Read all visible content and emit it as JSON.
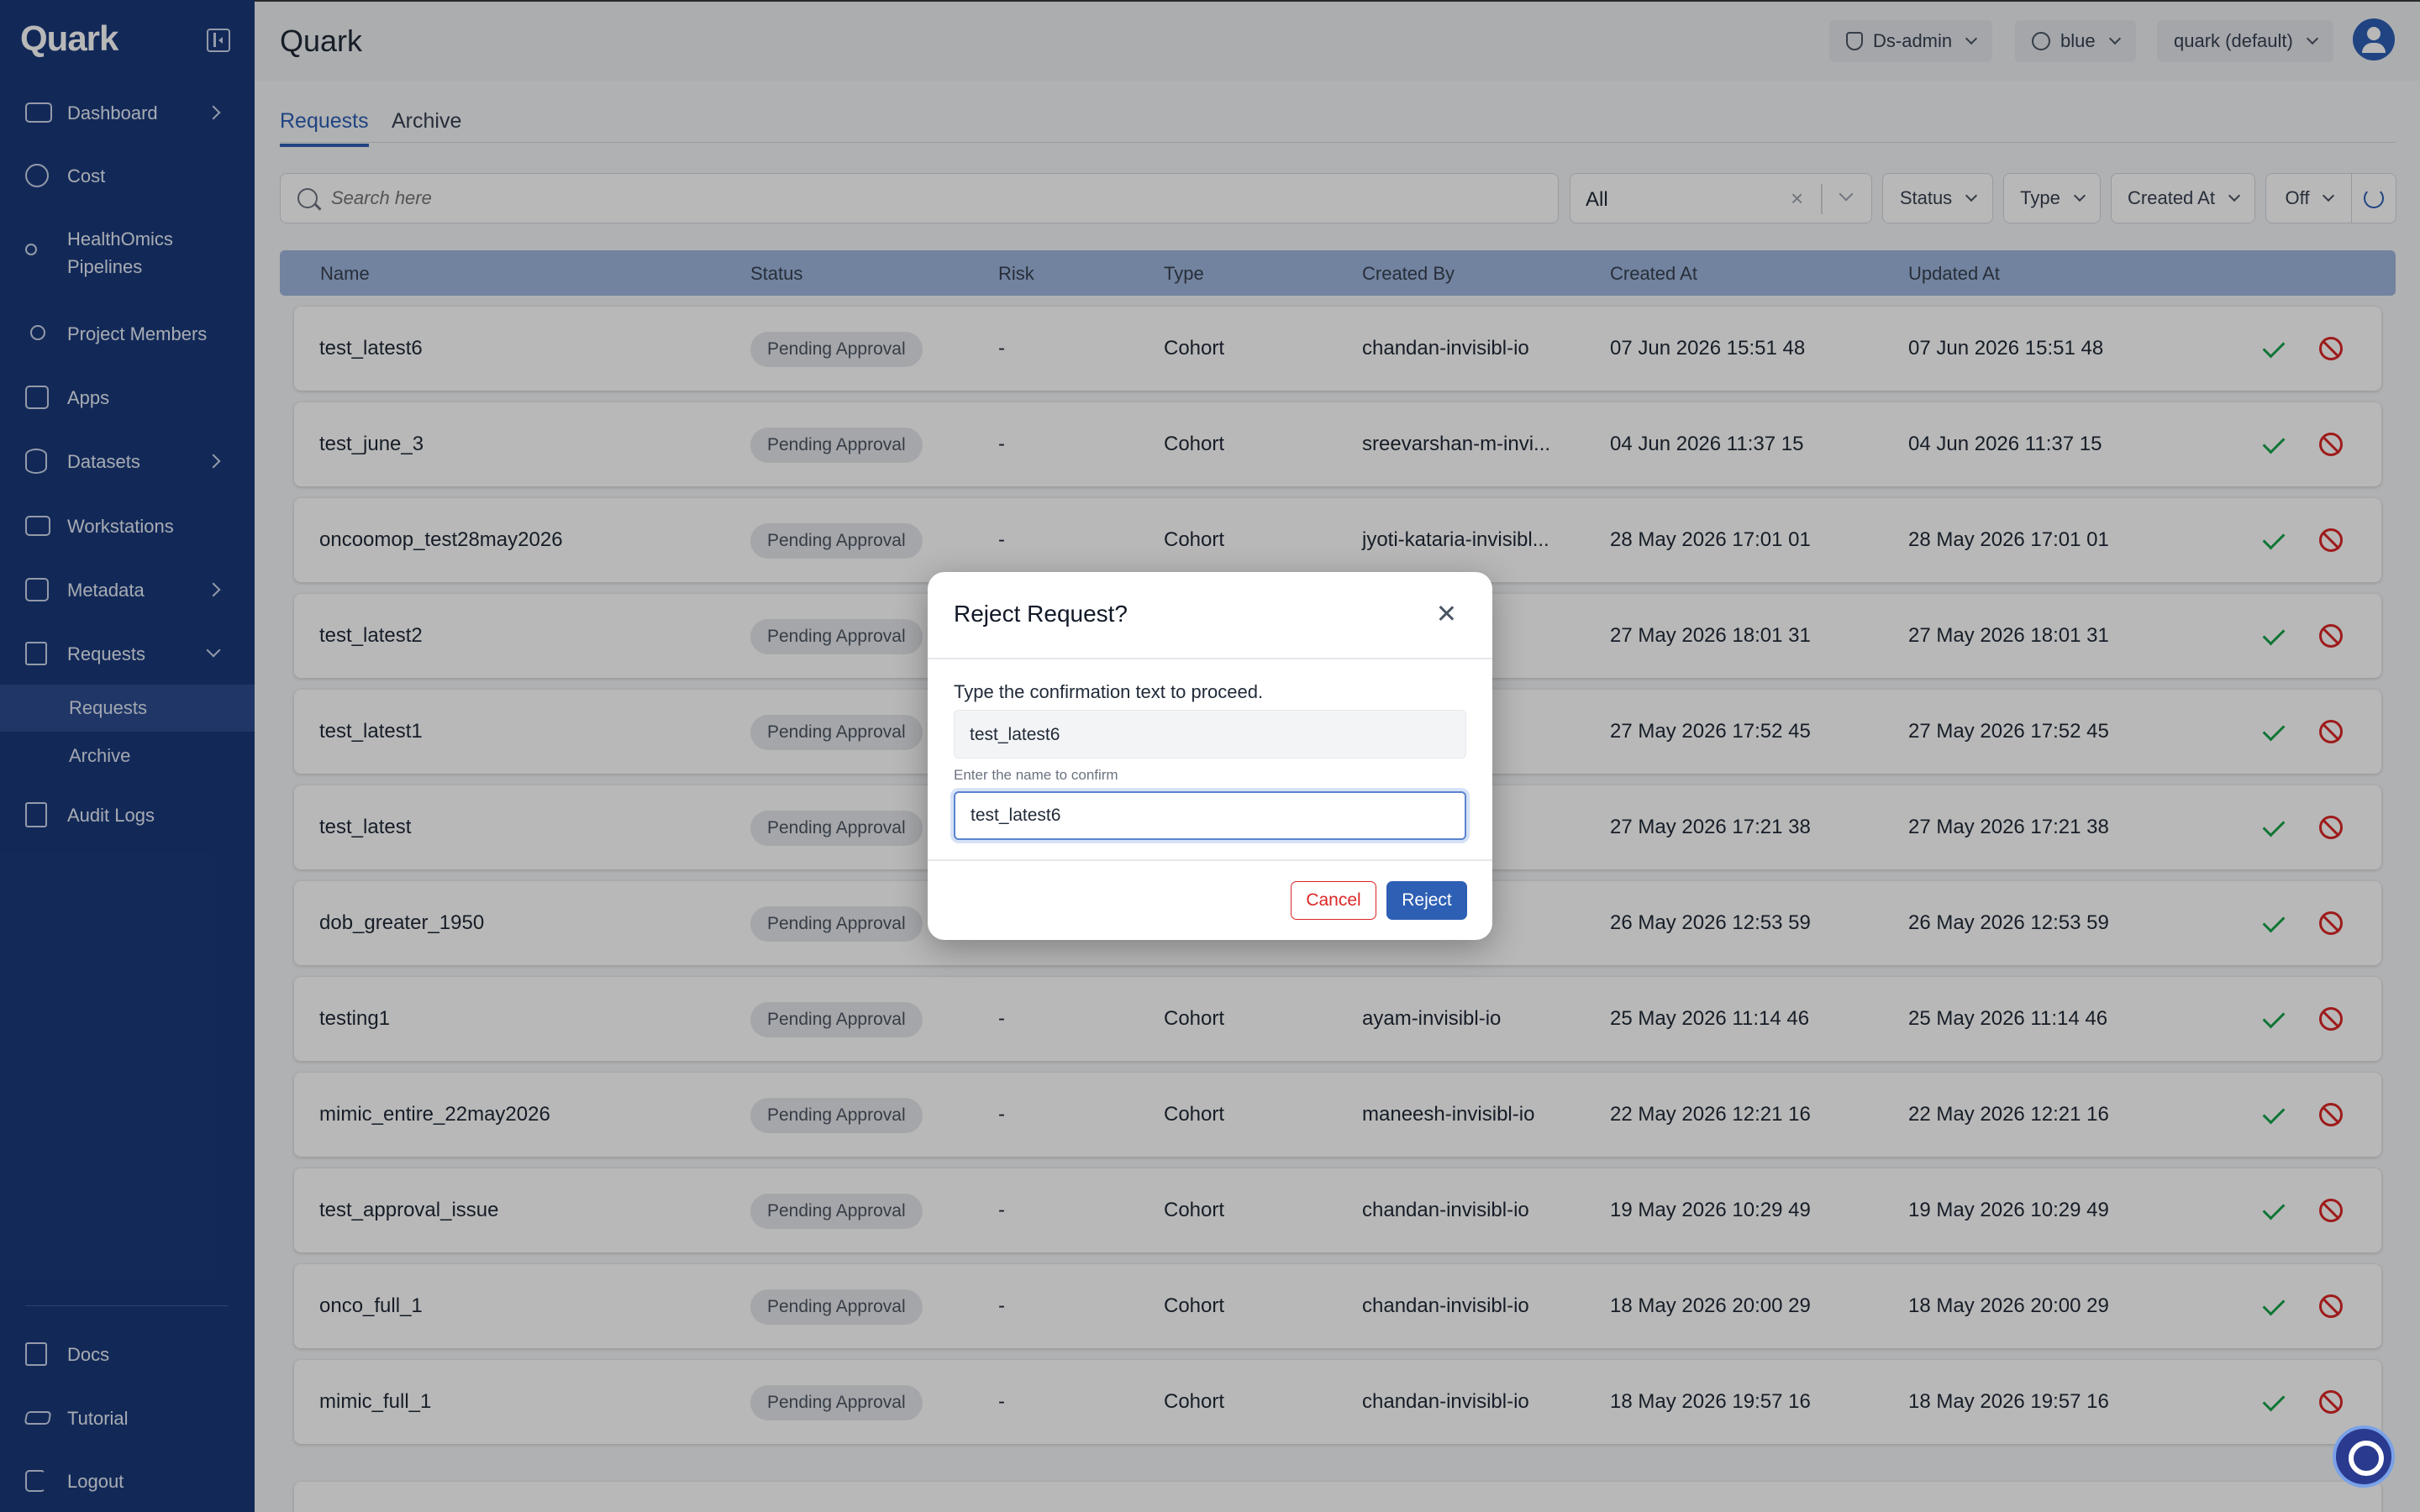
{
  "app": {
    "brand": "Quark",
    "page_title": "Quark"
  },
  "sidebar": {
    "items": [
      {
        "label": "Dashboard",
        "icon": "dashboard-icon",
        "chevron": "right"
      },
      {
        "label": "Cost",
        "icon": "dollar-icon"
      },
      {
        "label_line1": "HealthOmics",
        "label_line2": "Pipelines",
        "icon": "pipeline-icon"
      },
      {
        "label": "Project Members",
        "icon": "users-icon"
      },
      {
        "label": "Apps",
        "icon": "apps-icon"
      },
      {
        "label": "Datasets",
        "icon": "database-icon",
        "chevron": "right"
      },
      {
        "label": "Workstations",
        "icon": "workstation-icon"
      },
      {
        "label": "Metadata",
        "icon": "code-icon",
        "chevron": "right"
      },
      {
        "label": "Requests",
        "icon": "requests-icon",
        "chevron": "down"
      },
      {
        "label": "Audit Logs",
        "icon": "audit-icon"
      }
    ],
    "sub_items": [
      {
        "label": "Requests",
        "active": true
      },
      {
        "label": "Archive",
        "active": false
      }
    ],
    "footer": [
      {
        "label": "Docs",
        "icon": "docs-icon"
      },
      {
        "label": "Tutorial",
        "icon": "graduation-cap-icon"
      },
      {
        "label": "Logout",
        "icon": "logout-icon"
      }
    ]
  },
  "header": {
    "role": "Ds-admin",
    "theme": "blue",
    "project": "quark (default)"
  },
  "tabs": [
    {
      "label": "Requests",
      "active": true
    },
    {
      "label": "Archive",
      "active": false
    }
  ],
  "filters": {
    "search_placeholder": "Search here",
    "select_value": "All",
    "clear": "×",
    "status": "Status",
    "type": "Type",
    "created_at": "Created At",
    "auto_refresh": "Off"
  },
  "table": {
    "headers": [
      "Name",
      "Status",
      "Risk",
      "Type",
      "Created By",
      "Created At",
      "Updated At"
    ],
    "rows": [
      {
        "name": "test_latest6",
        "status": "Pending Approval",
        "risk": "-",
        "type": "Cohort",
        "created_by": "chandan-invisibl-io",
        "created_at": "07 Jun 2026 15:51 48",
        "updated_at": "07 Jun 2026 15:51 48"
      },
      {
        "name": "test_june_3",
        "status": "Pending Approval",
        "risk": "-",
        "type": "Cohort",
        "created_by": "sreevarshan-m-invi...",
        "created_at": "04 Jun 2026 11:37 15",
        "updated_at": "04 Jun 2026 11:37 15"
      },
      {
        "name": "oncoomop_test28may2026",
        "status": "Pending Approval",
        "risk": "-",
        "type": "Cohort",
        "created_by": "jyoti-kataria-invisibl...",
        "created_at": "28 May 2026 17:01 01",
        "updated_at": "28 May 2026 17:01 01"
      },
      {
        "name": "test_latest2",
        "status": "Pending Approval",
        "risk": "",
        "type": "",
        "created_by": "bl-io",
        "created_at": "27 May 2026 18:01 31",
        "updated_at": "27 May 2026 18:01 31"
      },
      {
        "name": "test_latest1",
        "status": "Pending Approval",
        "risk": "",
        "type": "",
        "created_by": "bl-io",
        "created_at": "27 May 2026 17:52 45",
        "updated_at": "27 May 2026 17:52 45"
      },
      {
        "name": "test_latest",
        "status": "Pending Approval",
        "risk": "",
        "type": "",
        "created_by": "bl-io",
        "created_at": "27 May 2026 17:21 38",
        "updated_at": "27 May 2026 17:21 38"
      },
      {
        "name": "dob_greater_1950",
        "status": "Pending Approval",
        "risk": "",
        "type": "",
        "created_by": "a-invi...",
        "created_at": "26 May 2026 12:53 59",
        "updated_at": "26 May 2026 12:53 59"
      },
      {
        "name": "testing1",
        "status": "Pending Approval",
        "risk": "-",
        "type": "Cohort",
        "created_by": "ayam-invisibl-io",
        "created_at": "25 May 2026 11:14 46",
        "updated_at": "25 May 2026 11:14 46"
      },
      {
        "name": "mimic_entire_22may2026",
        "status": "Pending Approval",
        "risk": "-",
        "type": "Cohort",
        "created_by": "maneesh-invisibl-io",
        "created_at": "22 May 2026 12:21 16",
        "updated_at": "22 May 2026 12:21 16"
      },
      {
        "name": "test_approval_issue",
        "status": "Pending Approval",
        "risk": "-",
        "type": "Cohort",
        "created_by": "chandan-invisibl-io",
        "created_at": "19 May 2026 10:29 49",
        "updated_at": "19 May 2026 10:29 49"
      },
      {
        "name": "onco_full_1",
        "status": "Pending Approval",
        "risk": "-",
        "type": "Cohort",
        "created_by": "chandan-invisibl-io",
        "created_at": "18 May 2026 20:00 29",
        "updated_at": "18 May 2026 20:00 29"
      },
      {
        "name": "mimic_full_1",
        "status": "Pending Approval",
        "risk": "-",
        "type": "Cohort",
        "created_by": "chandan-invisibl-io",
        "created_at": "18 May 2026 19:57 16",
        "updated_at": "18 May 2026 19:57 16"
      }
    ]
  },
  "modal": {
    "title": "Reject Request?",
    "prompt": "Type the confirmation text to proceed.",
    "confirmation_text": "test_latest6",
    "helper": "Enter the name to confirm",
    "input_value": "test_latest6",
    "cancel_label": "Cancel",
    "reject_label": "Reject"
  },
  "colors": {
    "sidebar_bg": "#1a3a7a",
    "accent": "#2d5fb4",
    "approve": "#16a34a",
    "reject": "#dc2626"
  }
}
